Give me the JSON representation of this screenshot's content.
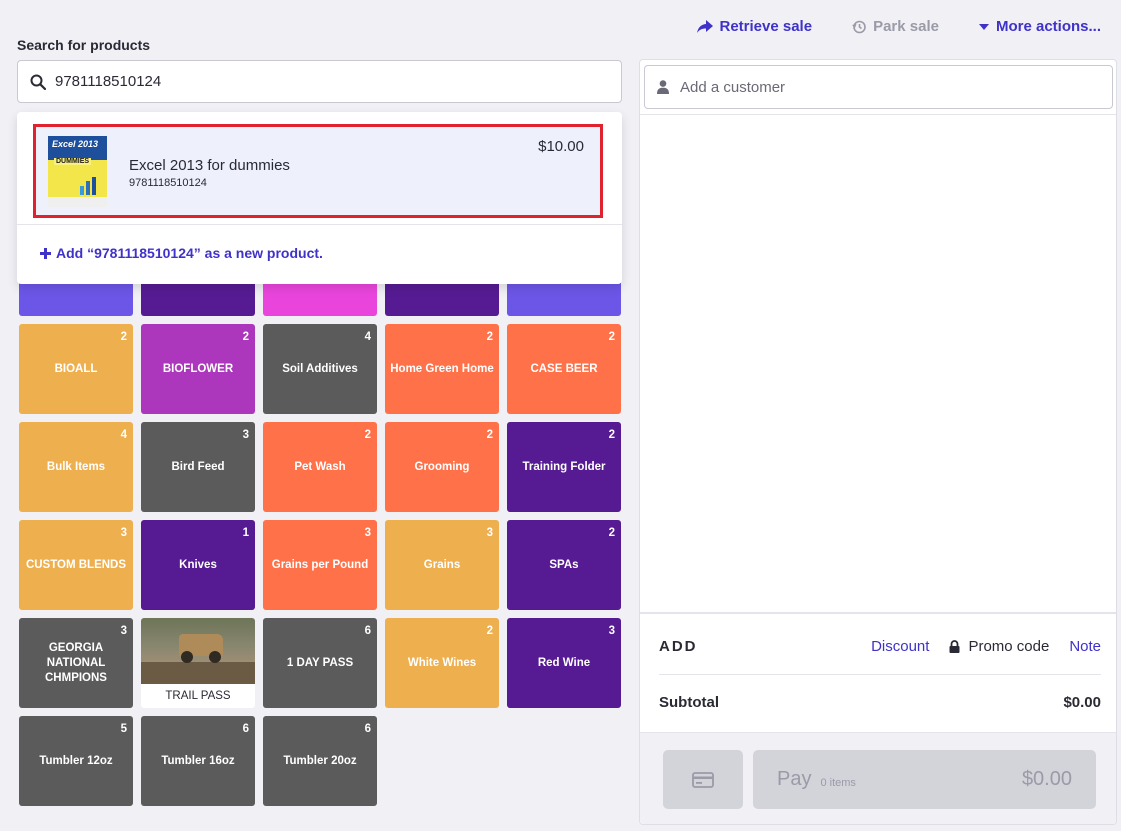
{
  "top_actions": {
    "retrieve_sale": "Retrieve sale",
    "park_sale": "Park sale",
    "more_actions": "More actions..."
  },
  "search": {
    "label": "Search for products",
    "value": "9781118510124",
    "placeholder": ""
  },
  "dropdown": {
    "result": {
      "name": "Excel 2013 for dummies",
      "code": "9781118510124",
      "price": "$10.00",
      "thumb_title": "Excel 2013",
      "thumb_sub": "DUMMIES"
    },
    "add_new_label": "Add “9781118510124” as a new product."
  },
  "tiles_partial_colors": [
    "#6c56e8",
    "#561b93",
    "#e945dc",
    "#561b93",
    "#6c56e8"
  ],
  "tiles": [
    {
      "label": "BIOALL",
      "count": "2",
      "color": "#eeaf4f"
    },
    {
      "label": "BIOFLOWER",
      "count": "2",
      "color": "#ad37bc"
    },
    {
      "label": "Soil Additives",
      "count": "4",
      "color": "#5b5b5b"
    },
    {
      "label": "Home Green Home",
      "count": "2",
      "color": "#ff7249"
    },
    {
      "label": "CASE BEER",
      "count": "2",
      "color": "#ff7249"
    },
    {
      "label": "Bulk Items",
      "count": "4",
      "color": "#eeaf4f"
    },
    {
      "label": "Bird Feed",
      "count": "3",
      "color": "#5b5b5b"
    },
    {
      "label": "Pet Wash",
      "count": "2",
      "color": "#ff7249"
    },
    {
      "label": "Grooming",
      "count": "2",
      "color": "#ff7249"
    },
    {
      "label": "Training Folder",
      "count": "2",
      "color": "#561b93"
    },
    {
      "label": "CUSTOM BLENDS",
      "count": "3",
      "color": "#eeaf4f"
    },
    {
      "label": "Knives",
      "count": "1",
      "color": "#561b93"
    },
    {
      "label": "Grains per Pound",
      "count": "3",
      "color": "#ff7249"
    },
    {
      "label": "Grains",
      "count": "3",
      "color": "#eeaf4f"
    },
    {
      "label": "SPAs",
      "count": "2",
      "color": "#561b93"
    },
    {
      "label": "GEORGIA NATIONAL CHMPIONS",
      "count": "3",
      "color": "#5b5b5b"
    },
    {
      "label": "TRAIL PASS",
      "count": "",
      "color": "#ffffff",
      "image": true
    },
    {
      "label": "1 DAY PASS",
      "count": "6",
      "color": "#5b5b5b"
    },
    {
      "label": "White Wines",
      "count": "2",
      "color": "#eeaf4f"
    },
    {
      "label": "Red Wine",
      "count": "3",
      "color": "#561b93"
    },
    {
      "label": "Tumbler 12oz",
      "count": "5",
      "color": "#5b5b5b"
    },
    {
      "label": "Tumbler 16oz",
      "count": "6",
      "color": "#5b5b5b"
    },
    {
      "label": "Tumbler 20oz",
      "count": "6",
      "color": "#5b5b5b"
    }
  ],
  "sale": {
    "customer_placeholder": "Add a customer",
    "add_title": "ADD",
    "discount": "Discount",
    "promo_code": "Promo code",
    "note": "Note",
    "subtotal_label": "Subtotal",
    "subtotal_value": "$0.00",
    "pay_label": "Pay",
    "pay_items": "0 items",
    "pay_amount": "$0.00"
  },
  "colors": {
    "accent": "#3f32c8",
    "highlight_border": "#e0222e"
  }
}
